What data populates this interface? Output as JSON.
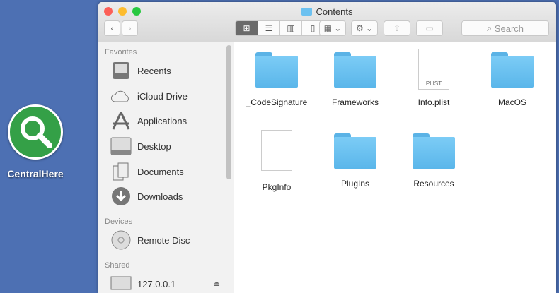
{
  "desktop": {
    "app_label": "CentralHere"
  },
  "window": {
    "title": "Contents",
    "search_placeholder": "Search"
  },
  "sidebar": {
    "favorites_header": "Favorites",
    "favorites": [
      "Recents",
      "iCloud Drive",
      "Applications",
      "Desktop",
      "Documents",
      "Downloads"
    ],
    "devices_header": "Devices",
    "devices": [
      "Remote Disc"
    ],
    "shared_header": "Shared",
    "shared": [
      "127.0.0.1"
    ]
  },
  "files": [
    {
      "name": "_CodeSignature",
      "type": "folder"
    },
    {
      "name": "Frameworks",
      "type": "folder"
    },
    {
      "name": "Info.plist",
      "type": "plist",
      "badge": "PLIST"
    },
    {
      "name": "MacOS",
      "type": "folder"
    },
    {
      "name": "PkgInfo",
      "type": "doc"
    },
    {
      "name": "PlugIns",
      "type": "folder"
    },
    {
      "name": "Resources",
      "type": "folder"
    }
  ]
}
